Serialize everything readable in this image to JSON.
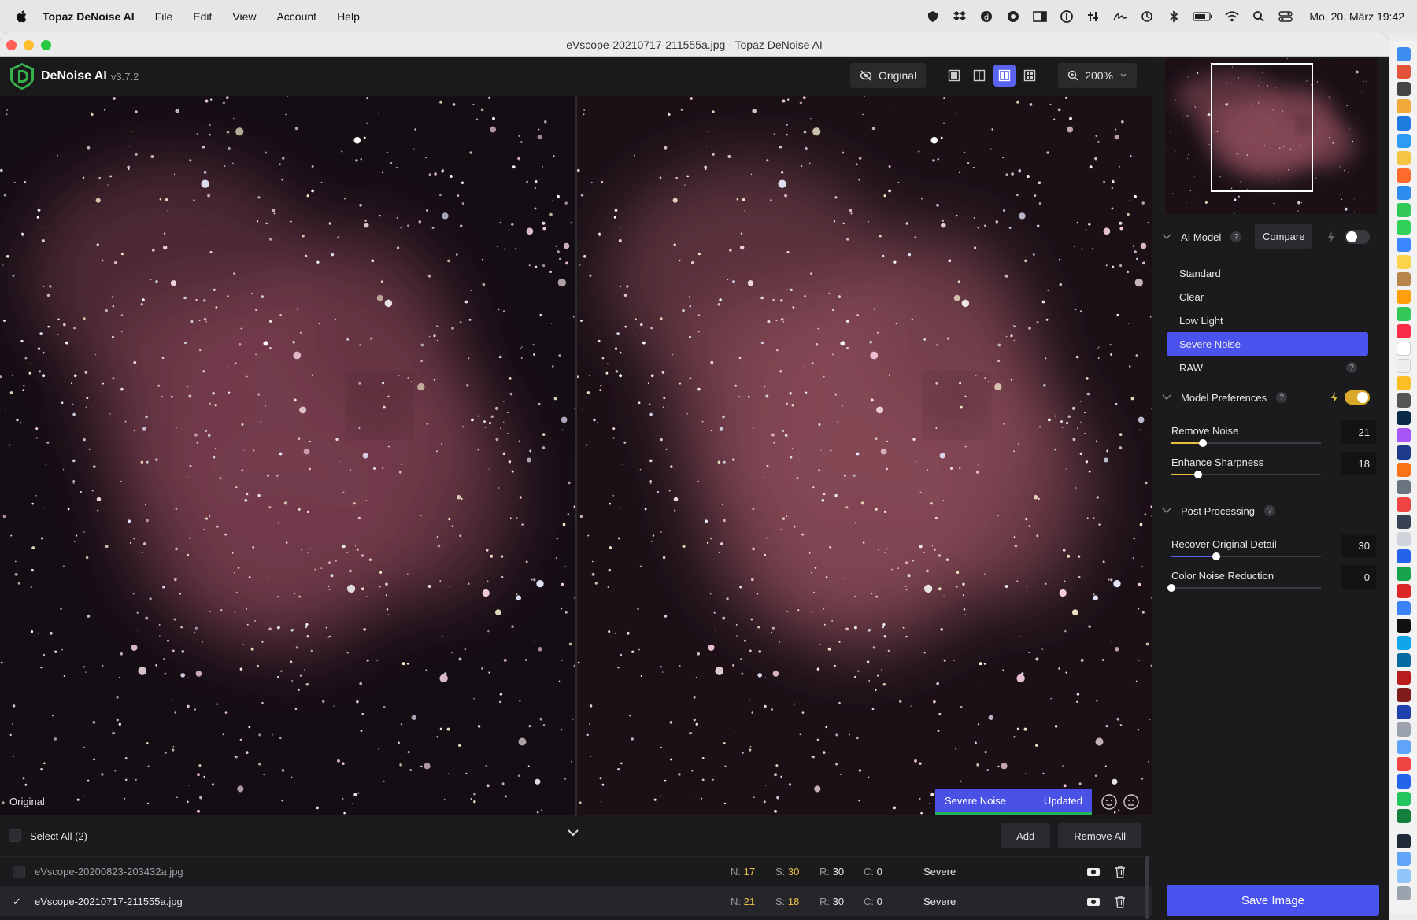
{
  "menubar": {
    "app_name": "Topaz DeNoise AI",
    "items": [
      "File",
      "Edit",
      "View",
      "Account",
      "Help"
    ],
    "clock": "Mo. 20. März  19:42"
  },
  "window": {
    "title": "eVscope-20210717-211555a.jpg - Topaz DeNoise AI"
  },
  "toolbar": {
    "app_name": "DeNoise AI",
    "version": "v3.7.2",
    "original_label": "Original",
    "zoom_label": "200%"
  },
  "preview": {
    "left_label": "Original",
    "model_tag": "Severe Noise",
    "status_tag": "Updated"
  },
  "filebar": {
    "select_all_label": "Select All (2)",
    "add_label": "Add",
    "remove_all_label": "Remove All",
    "files": [
      {
        "name": "eVscope-20200823-203432a.jpg",
        "n_label": "N:",
        "n": "17",
        "s_label": "S:",
        "s": "30",
        "r_label": "R:",
        "r": "30",
        "c_label": "C:",
        "c": "0",
        "mode": "Severe",
        "selected": false
      },
      {
        "name": "eVscope-20210717-211555a.jpg",
        "n_label": "N:",
        "n": "21",
        "s_label": "S:",
        "s": "18",
        "r_label": "R:",
        "r": "30",
        "c_label": "C:",
        "c": "0",
        "mode": "Severe",
        "selected": true
      }
    ]
  },
  "panel": {
    "ai_model": {
      "title": "AI Model",
      "compare_label": "Compare",
      "models": [
        "Standard",
        "Clear",
        "Low Light",
        "Severe Noise",
        "RAW"
      ],
      "selected": "Severe Noise"
    },
    "model_preferences": {
      "title": "Model Preferences",
      "remove_noise": {
        "label": "Remove Noise",
        "value": "21",
        "fraction": 0.21
      },
      "enhance_sharpness": {
        "label": "Enhance Sharpness",
        "value": "18",
        "fraction": 0.18
      }
    },
    "post_processing": {
      "title": "Post Processing",
      "recover_detail": {
        "label": "Recover Original Detail",
        "value": "30",
        "fraction": 0.3
      },
      "color_noise": {
        "label": "Color Noise Reduction",
        "value": "0",
        "fraction": 0.0
      }
    },
    "save_label": "Save Image",
    "help_glyph": "?"
  },
  "colors": {
    "accent": "#4b53ef",
    "slider_fill_yellow": "#e7c043",
    "slider_fill_blue": "#5a62f0",
    "toggle_on": "#d9a72a",
    "updated_bar": "#21b35a"
  }
}
